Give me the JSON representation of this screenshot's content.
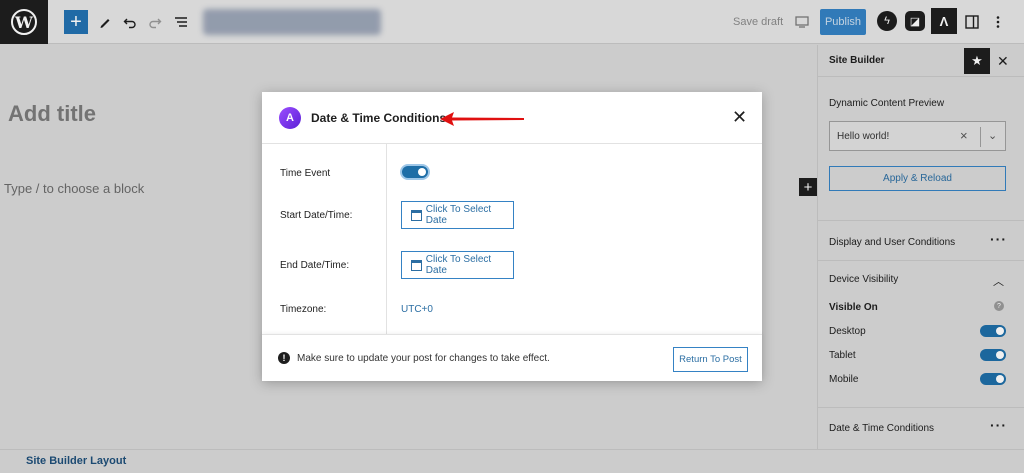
{
  "topbar": {
    "wp_logo": "W",
    "add_icon": "+",
    "save_draft": "Save draft",
    "publish": "Publish"
  },
  "editor": {
    "title_placeholder": "Add title",
    "block_hint": "Type / to choose a block",
    "block_add": "+"
  },
  "footer": {
    "label": "Site Builder Layout"
  },
  "sidebar": {
    "title": "Site Builder",
    "dynamic_preview_label": "Dynamic Content Preview",
    "preview_value": "Hello world!",
    "apply_button": "Apply & Reload",
    "display_conditions": "Display and User Conditions",
    "device_visibility": "Device Visibility",
    "visible_on": "Visible On",
    "devices": [
      {
        "label": "Desktop",
        "enabled": true
      },
      {
        "label": "Tablet",
        "enabled": true
      },
      {
        "label": "Mobile",
        "enabled": true
      }
    ],
    "date_time_conditions": "Date & Time Conditions"
  },
  "modal": {
    "title": "Date & Time Conditions",
    "logo_letter": "A",
    "rows": {
      "time_event": "Time Event",
      "start": "Start Date/Time:",
      "end": "End Date/Time:",
      "timezone": "Timezone:"
    },
    "time_event_enabled": true,
    "start_button": "Click To Select Date",
    "end_button": "Click To Select Date",
    "timezone_value": "UTC+0",
    "footer_note": "Make sure to update your post for changes to take effect.",
    "return_button": "Return To Post"
  },
  "colors": {
    "accent": "#3582c4",
    "toggle_on": "#1e6ea7",
    "annotation_arrow": "#e01010"
  }
}
